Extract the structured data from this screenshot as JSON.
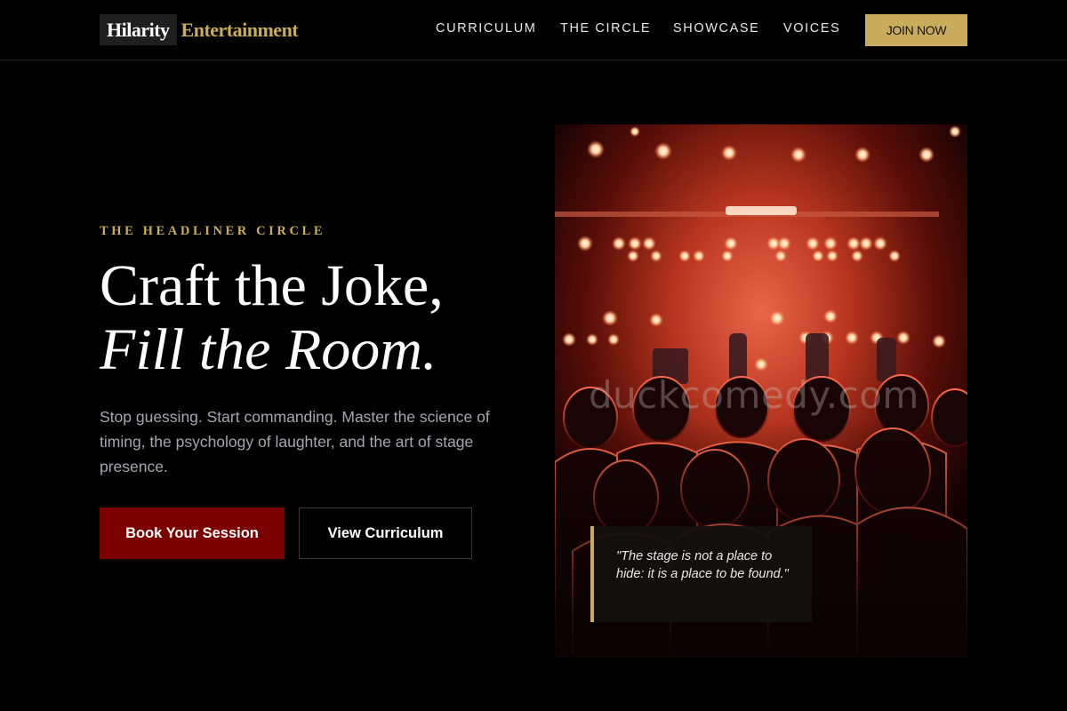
{
  "brand": {
    "name_box": "Hilarity",
    "name_text": "Entertainment"
  },
  "nav": {
    "items": [
      {
        "label": "CURRICULUM"
      },
      {
        "label": "THE CIRCLE"
      },
      {
        "label": "SHOWCASE"
      },
      {
        "label": "VOICES"
      }
    ],
    "cta_label": "JOIN NOW"
  },
  "hero": {
    "eyebrow": "THE HEADLINER CIRCLE",
    "headline_line1": "Craft the Joke,",
    "headline_line2": "Fill the Room.",
    "subtitle": "Stop guessing. Start commanding. Master the science of timing, the psychology of laughter, and the art of stage presence.",
    "primary_button": "Book Your Session",
    "secondary_button": "View Curriculum"
  },
  "photo": {
    "watermark": "duckcomedy.com",
    "quote": "\"The stage is not a place to hide: it is a place to be found.\""
  },
  "colors": {
    "accent_gold": "#c9ad5c",
    "primary_red": "#7c0000",
    "background": "#000000"
  }
}
